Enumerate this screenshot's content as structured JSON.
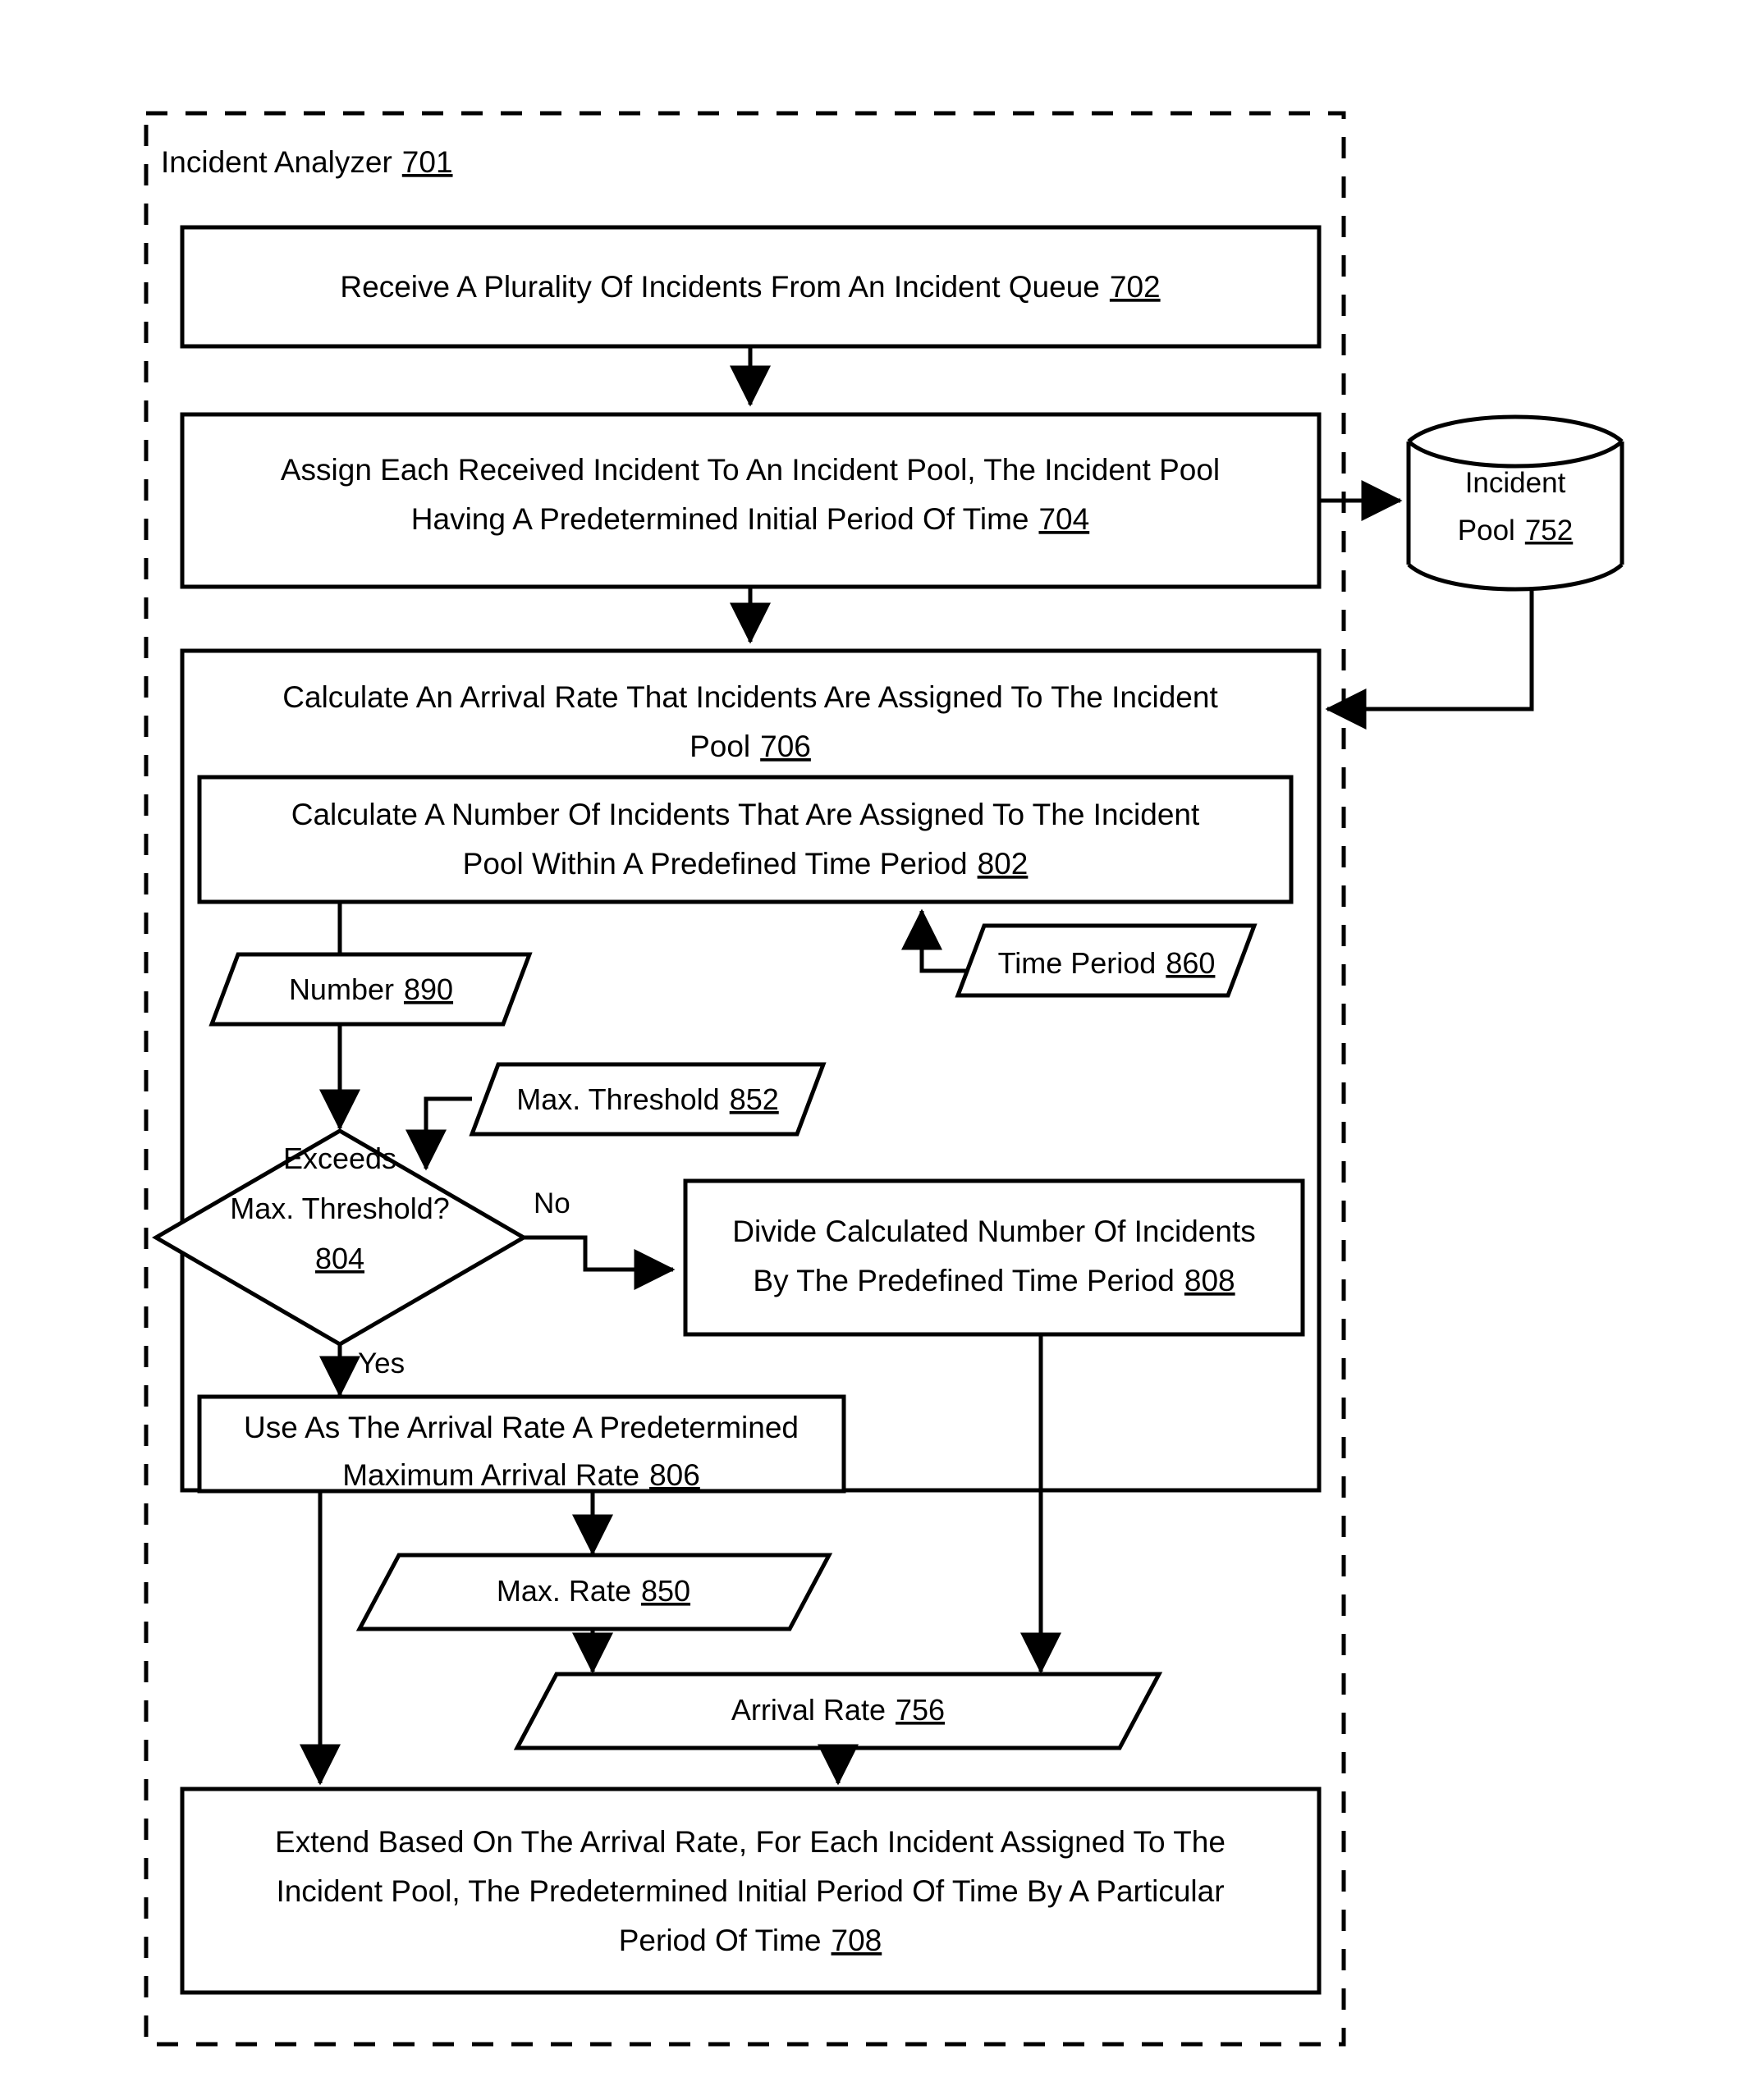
{
  "figure": {
    "container_label": "Incident Analyzer",
    "container_ref": "701"
  },
  "nodes": {
    "step702": {
      "line1": "Receive A Plurality Of Incidents From An Incident Queue",
      "ref": "702"
    },
    "step704": {
      "line1": "Assign Each Received Incident To An Incident Pool, The Incident Pool",
      "line2": "Having A Predetermined Initial Period Of Time",
      "ref": "704"
    },
    "step706": {
      "line1": "Calculate An Arrival Rate That Incidents Are Assigned To The Incident",
      "line2": "Pool",
      "ref": "706"
    },
    "step802": {
      "line1": "Calculate A Number Of Incidents That Are Assigned To The Incident",
      "line2": "Pool Within A Predefined Time Period",
      "ref": "802"
    },
    "step808": {
      "line1": "Divide Calculated Number Of Incidents",
      "line2": "By The Predefined Time Period",
      "ref": "808"
    },
    "step806": {
      "line1": "Use As The Arrival Rate A Predetermined",
      "line2": "Maximum Arrival Rate",
      "ref": "806"
    },
    "step708": {
      "line1": "Extend Based On The Arrival Rate, For Each Incident Assigned To The",
      "line2": "Incident Pool, The Predetermined Initial Period Of Time By A Particular",
      "line3": "Period Of Time",
      "ref": "708"
    },
    "decision804": {
      "line1": "Exceeds",
      "line2": "Max. Threshold?",
      "ref": "804"
    },
    "datastore752": {
      "line1": "Incident",
      "line2": "Pool",
      "ref": "752"
    },
    "data890": {
      "label": "Number",
      "ref": "890"
    },
    "data860": {
      "label": "Time Period",
      "ref": "860"
    },
    "data852": {
      "label": "Max. Threshold",
      "ref": "852"
    },
    "data850": {
      "label": "Max. Rate",
      "ref": "850"
    },
    "data756": {
      "label": "Arrival Rate",
      "ref": "756"
    }
  },
  "branches": {
    "no_label": "No",
    "yes_label": "Yes"
  },
  "colors": {
    "stroke": "#000000",
    "fill": "#ffffff"
  }
}
